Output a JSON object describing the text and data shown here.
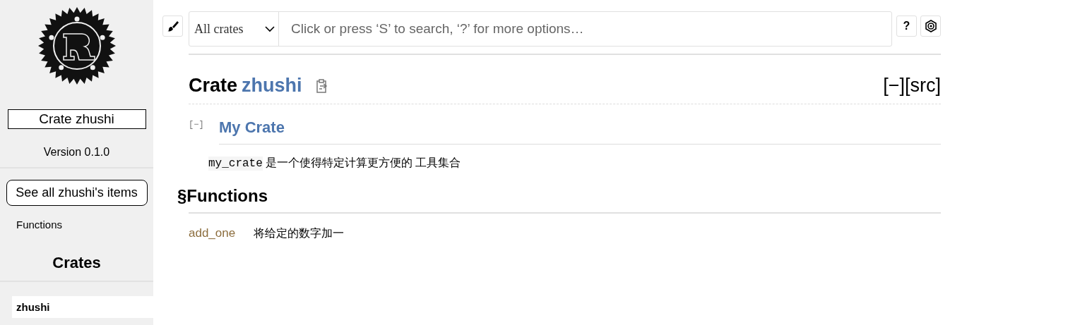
{
  "sidebar": {
    "crate_title": "Crate zhushi",
    "version": "Version 0.1.0",
    "all_items_button": "See all zhushi's items",
    "sections": [
      {
        "label": "Functions",
        "selected": false
      }
    ],
    "crates_heading": "Crates",
    "crates": [
      {
        "label": "zhushi",
        "selected": true
      }
    ]
  },
  "toolbar": {
    "crate_filter": "All crates",
    "search": {
      "placeholder": "Click or press ‘S’ to search, ‘?’ for more options…"
    },
    "help_button": "?"
  },
  "header": {
    "kind_label": "Crate",
    "name": "zhushi",
    "out_of_band": "[−][src]"
  },
  "docblock": {
    "toggle": "[−]",
    "heading": "My Crate",
    "code": "my_crate",
    "text": "是一个使得特定计算更方便的 工具集合"
  },
  "sections": [
    {
      "anchor": "§",
      "title": "Functions",
      "items": [
        {
          "name": "add_one",
          "description": "将给定的数字加一"
        }
      ]
    }
  ]
}
